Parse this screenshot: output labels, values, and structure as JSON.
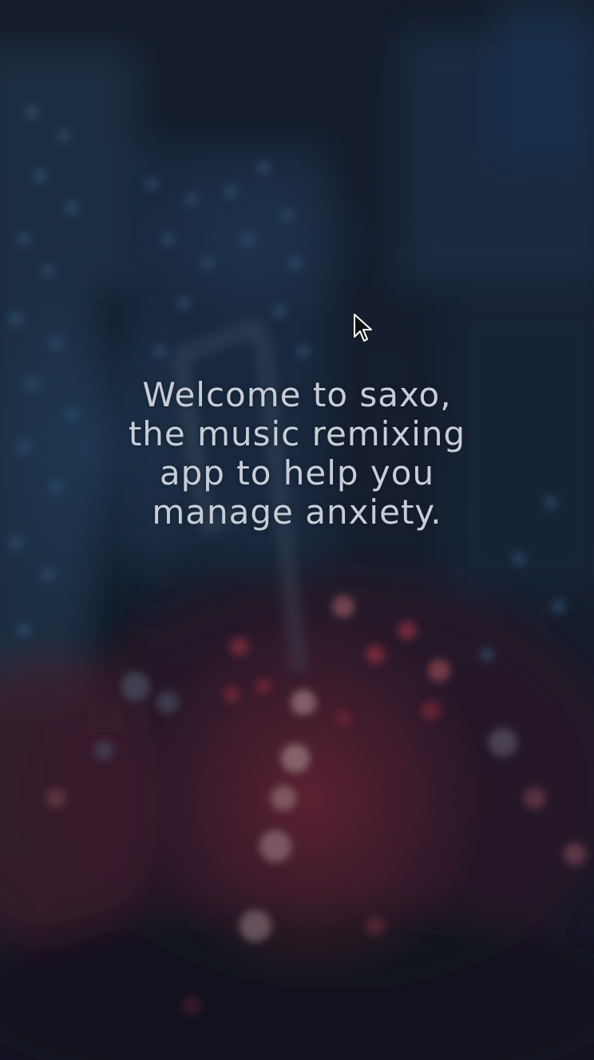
{
  "welcome": {
    "line1": "Welcome to saxo,",
    "line2": "the music remixing",
    "line3": "app to help you",
    "line4": "manage anxiety."
  },
  "background": {
    "description_icon": "blurred-city-night-photo",
    "colors": {
      "base": "#161a26",
      "building_blue": "#26425e",
      "light_red": "#b5394c",
      "light_warm": "#d9a0a0"
    }
  },
  "cursor": {
    "icon": "mouse-pointer-icon"
  }
}
